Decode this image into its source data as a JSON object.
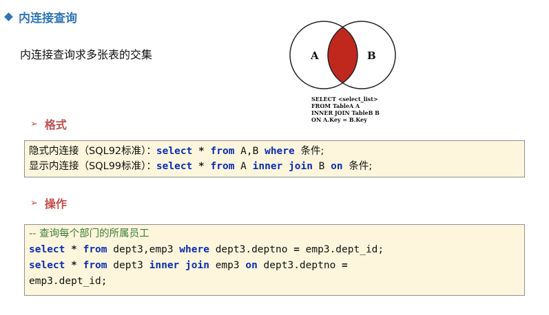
{
  "title": "内连接查询",
  "intro": "内连接查询求多张表的交集",
  "venn": {
    "label_a": "A",
    "label_b": "B",
    "intersection_color": "#c0281e",
    "caption": [
      "SELECT <select_list>",
      "FROM TableA A",
      "INNER JOIN TableB B",
      "ON A.Key = B.Key"
    ]
  },
  "sections": {
    "format": "格式",
    "operation": "操作"
  },
  "format_box": {
    "implicit": {
      "label": "隐式内连接（SQL92标准）：",
      "t1": "select",
      "t2": "*",
      "t3": "from",
      "t4": "A,B",
      "t5": "where",
      "t6": "条件;"
    },
    "explicit": {
      "label": "显示内连接（SQL99标准）：",
      "t1": "select",
      "t2": "*",
      "t3": "from",
      "t4": "A",
      "t5": "inner join",
      "t6": "B",
      "t7": "on",
      "t8": "条件;"
    }
  },
  "operation_box": {
    "comment": "-- 查询每个部门的所属员工",
    "q1": {
      "t1": "select",
      "t2": "*",
      "t3": "from",
      "t4": "dept3,emp3",
      "t5": "where",
      "t6": "dept3.deptno",
      "t7": "=",
      "t8": "emp3.dept_id;"
    },
    "q2": {
      "t1": "select",
      "t2": "*",
      "t3": "from",
      "t4": "dept3",
      "t5": "inner join",
      "t6": "emp3",
      "t7": "on",
      "t8": "dept3.deptno",
      "t9": "="
    },
    "q2_cont": "emp3.dept_id;"
  },
  "colors": {
    "title": "#2e75b6",
    "section": "#c0504d",
    "keyword": "#0a2db5",
    "comment": "#3a7d3a",
    "code_bg": "#fdf6dc"
  }
}
